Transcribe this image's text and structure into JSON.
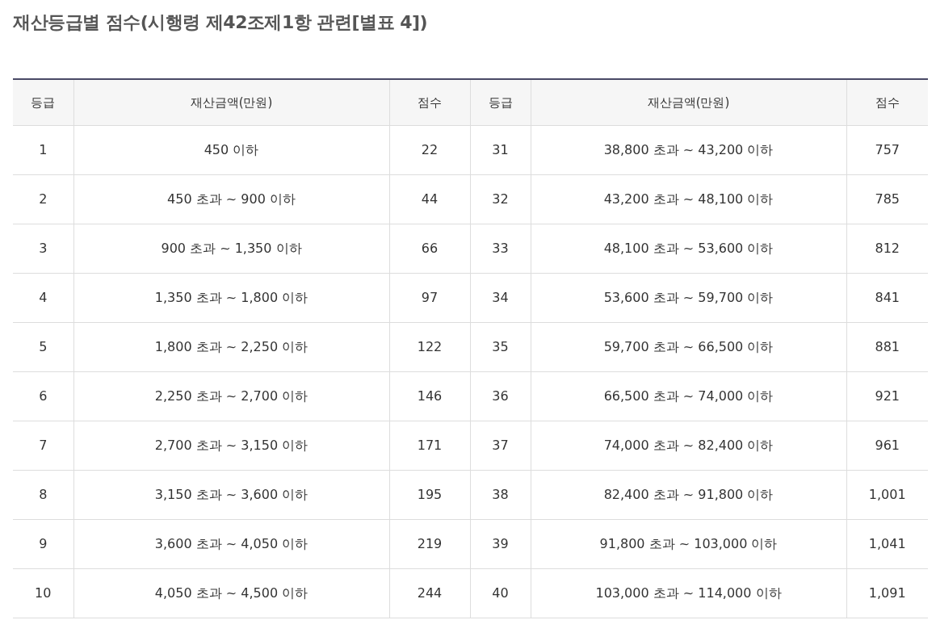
{
  "title": "재산등급별 점수(시행령 제42조제1항 관련[별표 4])",
  "table": {
    "columns": [
      "등급",
      "재산금액(만원)",
      "점수",
      "등급",
      "재산금액(만원)",
      "점수"
    ],
    "rows": [
      [
        "1",
        "450 이하",
        "22",
        "31",
        "38,800 초과 ~ 43,200 이하",
        "757"
      ],
      [
        "2",
        "450 초과 ~ 900 이하",
        "44",
        "32",
        "43,200 초과 ~ 48,100 이하",
        "785"
      ],
      [
        "3",
        "900 초과 ~ 1,350 이하",
        "66",
        "33",
        "48,100 초과 ~ 53,600 이하",
        "812"
      ],
      [
        "4",
        "1,350 초과 ~ 1,800 이하",
        "97",
        "34",
        "53,600 초과 ~ 59,700 이하",
        "841"
      ],
      [
        "5",
        "1,800 초과 ~ 2,250 이하",
        "122",
        "35",
        "59,700 초과 ~ 66,500 이하",
        "881"
      ],
      [
        "6",
        "2,250 초과 ~ 2,700 이하",
        "146",
        "36",
        "66,500 초과 ~ 74,000 이하",
        "921"
      ],
      [
        "7",
        "2,700 초과 ~ 3,150 이하",
        "171",
        "37",
        "74,000 초과 ~ 82,400 이하",
        "961"
      ],
      [
        "8",
        "3,150 초과 ~ 3,600 이하",
        "195",
        "38",
        "82,400 초과 ~ 91,800 이하",
        "1,001"
      ],
      [
        "9",
        "3,600 초과 ~ 4,050 이하",
        "219",
        "39",
        "91,800 초과 ~ 103,000 이하",
        "1,041"
      ],
      [
        "10",
        "4,050 초과 ~ 4,500 이하",
        "244",
        "40",
        "103,000 초과 ~ 114,000 이하",
        "1,091"
      ]
    ]
  }
}
